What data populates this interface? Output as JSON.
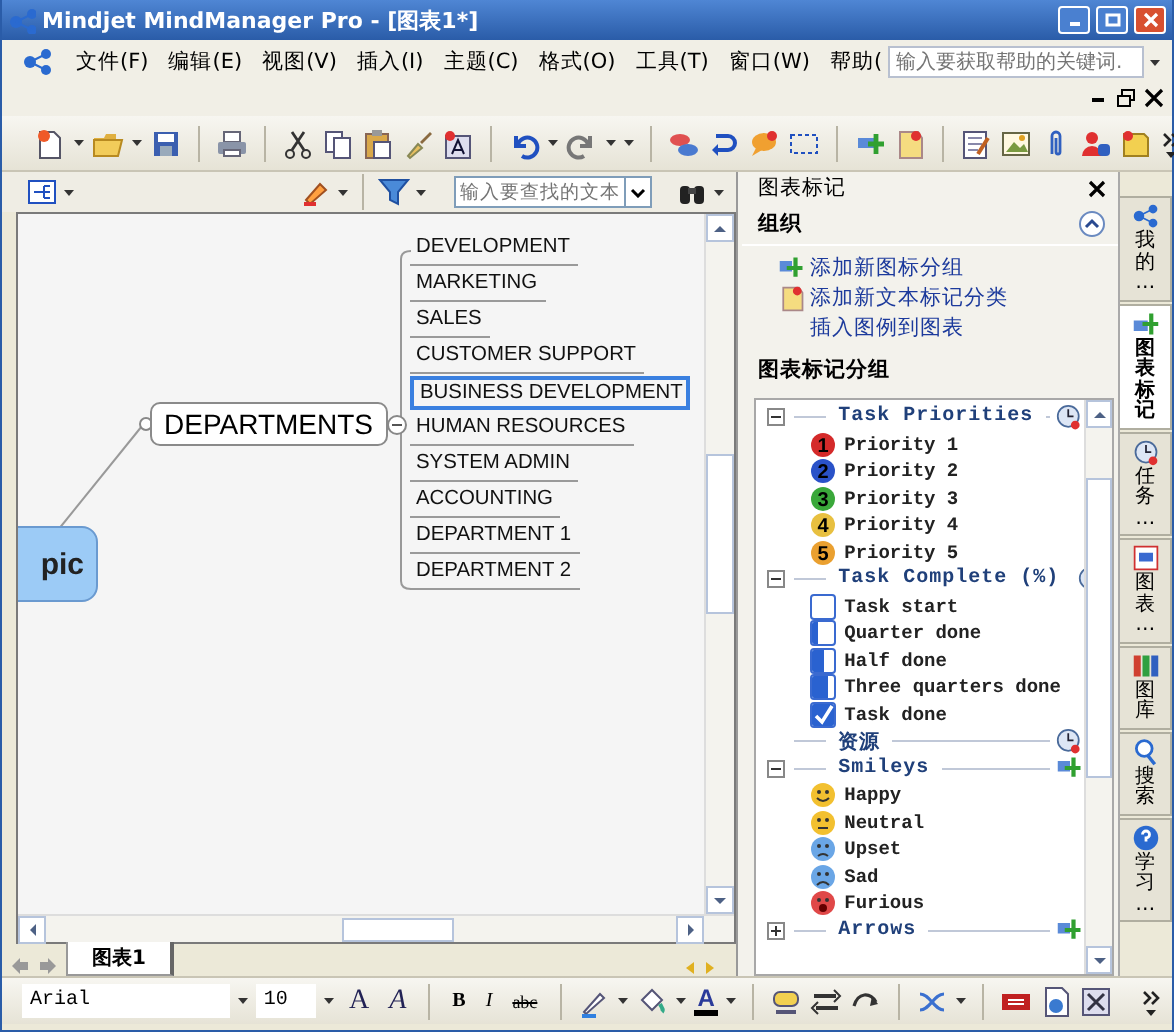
{
  "window": {
    "title": "Mindjet MindManager Pro - [图表1*]"
  },
  "menu_bar": {
    "items": [
      "文件(F)",
      "编辑(E)",
      "视图(V)",
      "插入(I)",
      "主题(C)",
      "格式(O)",
      "工具(T)",
      "窗口(W)",
      "帮助("
    ],
    "help_search": {
      "placeholder": "输入要获取帮助的关键词."
    }
  },
  "map_toolbar": {
    "search": {
      "placeholder": "输入要查找的文本"
    }
  },
  "mind_map": {
    "central_topic": "pic",
    "main_topic": "DEPARTMENTS",
    "subtopics": [
      {
        "label": "DEVELOPMENT",
        "selected": false
      },
      {
        "label": "MARKETING",
        "selected": false
      },
      {
        "label": "SALES",
        "selected": false
      },
      {
        "label": "CUSTOMER SUPPORT",
        "selected": false
      },
      {
        "label": "BUSINESS DEVELOPMENT",
        "selected": true
      },
      {
        "label": "HUMAN RESOURCES",
        "selected": false
      },
      {
        "label": "SYSTEM ADMIN",
        "selected": false
      },
      {
        "label": "ACCOUNTING",
        "selected": false
      },
      {
        "label": "DEPARTMENT 1",
        "selected": false
      },
      {
        "label": "DEPARTMENT 2",
        "selected": false
      }
    ]
  },
  "sheet_tabs": [
    {
      "label": "图表1",
      "selected": true
    }
  ],
  "task_pane": {
    "title": "图表标记",
    "organize": {
      "title": "组织",
      "links": [
        "添加新图标分组",
        "添加新文本标记分类",
        "插入图例到图表"
      ]
    },
    "groups_title": "图表标记分组",
    "groups": [
      {
        "name": "Task Priorities",
        "kind": "priority",
        "expanded": true,
        "items": [
          {
            "label": "Priority 1",
            "number": "1",
            "color": "#d42a2a"
          },
          {
            "label": "Priority 2",
            "number": "2",
            "color": "#2a52c8"
          },
          {
            "label": "Priority 3",
            "number": "3",
            "color": "#3aa83a"
          },
          {
            "label": "Priority 4",
            "number": "4",
            "color": "#e8c040"
          },
          {
            "label": "Priority 5",
            "number": "5",
            "color": "#eaa030"
          }
        ]
      },
      {
        "name": "Task Complete (%)",
        "kind": "progress",
        "expanded": true,
        "items": [
          {
            "label": "Task start",
            "level": 0
          },
          {
            "label": "Quarter done",
            "level": 0.25
          },
          {
            "label": "Half done",
            "level": 0.5
          },
          {
            "label": "Three quarters done",
            "level": 0.75
          },
          {
            "label": "Task done",
            "level": 1
          }
        ]
      },
      {
        "name": "资源",
        "kind": "resource"
      },
      {
        "name": "Smileys",
        "kind": "smiley",
        "expanded": true,
        "items": [
          {
            "label": "Happy",
            "kind": "happy",
            "color": "#f2c030"
          },
          {
            "label": "Neutral",
            "kind": "neutral",
            "color": "#f2c030"
          },
          {
            "label": "Upset",
            "kind": "upset",
            "color": "#6aa6e6"
          },
          {
            "label": "Sad",
            "kind": "sad",
            "color": "#6aa6e6"
          },
          {
            "label": "Furious",
            "kind": "furious",
            "color": "#e04848"
          }
        ]
      },
      {
        "name": "Arrows",
        "kind": "arrow",
        "expanded": false
      }
    ]
  },
  "side_tabs": [
    {
      "label": "我的…",
      "selected": false
    },
    {
      "label": "图表标记",
      "selected": true
    },
    {
      "label": "任务…",
      "selected": false
    },
    {
      "label": "图表…",
      "selected": false
    },
    {
      "label": "图库",
      "selected": false
    },
    {
      "label": "搜索",
      "selected": false
    },
    {
      "label": "学习…",
      "selected": false
    }
  ],
  "format_toolbar": {
    "font": "Arial",
    "size": "10",
    "buttons": [
      {
        "label": "A",
        "kind": "grow"
      },
      {
        "label": "A",
        "kind": "shrink"
      },
      {
        "label": "B",
        "kind": "bold"
      },
      {
        "label": "I",
        "kind": "italic"
      },
      {
        "label": "abc",
        "kind": "strike"
      }
    ],
    "font_color": "A"
  }
}
